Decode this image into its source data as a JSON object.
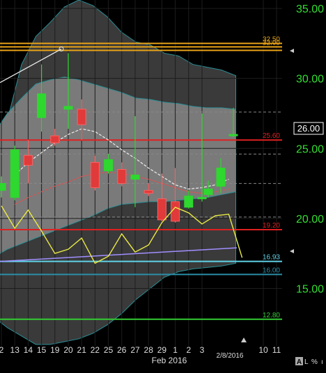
{
  "chart_data": {
    "type": "candlestick",
    "x_ticks": [
      "2",
      "13",
      "14",
      "15",
      "19",
      "20",
      "21",
      "22",
      "25",
      "26",
      "27",
      "28",
      "29",
      "1",
      "2",
      "3",
      "10",
      "11"
    ],
    "month_label": "Feb 2016",
    "date_badge": "2/8/2016",
    "y_ticks": [
      "35.00",
      "30.00",
      "25.00",
      "20.00",
      "15.00"
    ],
    "ylim": [
      10.9,
      35.6
    ],
    "last_price": "26.00",
    "level_lines": [
      {
        "label": "32.50",
        "value": 32.5,
        "color": "#e8a317"
      },
      {
        "label": "32.00",
        "value": 32.25,
        "color": "#e8a317"
      },
      {
        "label": "",
        "value": 32.0,
        "color": "#e8a317"
      },
      {
        "label": "25.60",
        "value": 25.6,
        "color": "#e02020"
      },
      {
        "label": "19.20",
        "value": 19.2,
        "color": "#e02020"
      },
      {
        "label": "16.93",
        "value": 16.93,
        "color": "#5fd4e8"
      },
      {
        "label": "16.00",
        "value": 16.0,
        "color": "#2a8fa8"
      },
      {
        "label": "12.80",
        "value": 12.8,
        "color": "#33cc33"
      }
    ],
    "dashed_levels": [
      27.6,
      24.6,
      22.5,
      20.1
    ],
    "candles": [
      {
        "x": "12",
        "open": 22.0,
        "close": 22.5,
        "high": 23.0,
        "low": 21.5
      },
      {
        "x": "13",
        "open": 21.5,
        "close": 24.9,
        "high": 25.2,
        "low": 21.3
      },
      {
        "x": "14",
        "open": 24.5,
        "close": 23.8,
        "high": 25.6,
        "low": 22.5
      },
      {
        "x": "15",
        "open": 27.2,
        "close": 28.9,
        "high": 31.0,
        "low": 26.2
      },
      {
        "x": "19",
        "open": 25.9,
        "close": 25.4,
        "high": 26.4,
        "low": 25.2
      },
      {
        "x": "20",
        "open": 27.8,
        "close": 28.0,
        "high": 31.8,
        "low": 26.4
      },
      {
        "x": "21",
        "open": 27.8,
        "close": 26.7,
        "high": 28.5,
        "low": 25.6
      },
      {
        "x": "22",
        "open": 24.0,
        "close": 22.2,
        "high": 24.5,
        "low": 22.0
      },
      {
        "x": "25",
        "open": 23.4,
        "close": 24.2,
        "high": 24.6,
        "low": 23.2
      },
      {
        "x": "26",
        "open": 23.5,
        "close": 22.5,
        "high": 24.0,
        "low": 22.3
      },
      {
        "x": "27",
        "open": 22.8,
        "close": 23.1,
        "high": 27.3,
        "low": 20.8
      },
      {
        "x": "28",
        "open": 22.0,
        "close": 21.8,
        "high": 22.5,
        "low": 21.6
      },
      {
        "x": "29",
        "open": 21.4,
        "close": 19.9,
        "high": 23.2,
        "low": 19.8
      },
      {
        "x": "1",
        "open": 21.2,
        "close": 19.8,
        "high": 23.6,
        "low": 19.7
      },
      {
        "x": "2",
        "open": 20.8,
        "close": 21.6,
        "high": 22.0,
        "low": 20.7
      },
      {
        "x": "3",
        "open": 21.4,
        "close": 21.5,
        "high": 27.5,
        "low": 21.2
      },
      {
        "x": "4",
        "open": 21.7,
        "close": 22.1,
        "high": 22.7,
        "low": 21.5
      },
      {
        "x": "5",
        "open": 22.3,
        "close": 23.6,
        "high": 24.3,
        "low": 21.8
      },
      {
        "x": "8",
        "open": 25.9,
        "close": 26.0,
        "high": 27.9,
        "low": 25.8
      }
    ],
    "oscillator": [
      20.9,
      19.3,
      20.6,
      19.1,
      17.5,
      17.8,
      18.6,
      16.8,
      17.3,
      18.9,
      17.6,
      18.1,
      19.7,
      20.8,
      20.4,
      19.6,
      20.2,
      20.3,
      17.2
    ]
  }
}
